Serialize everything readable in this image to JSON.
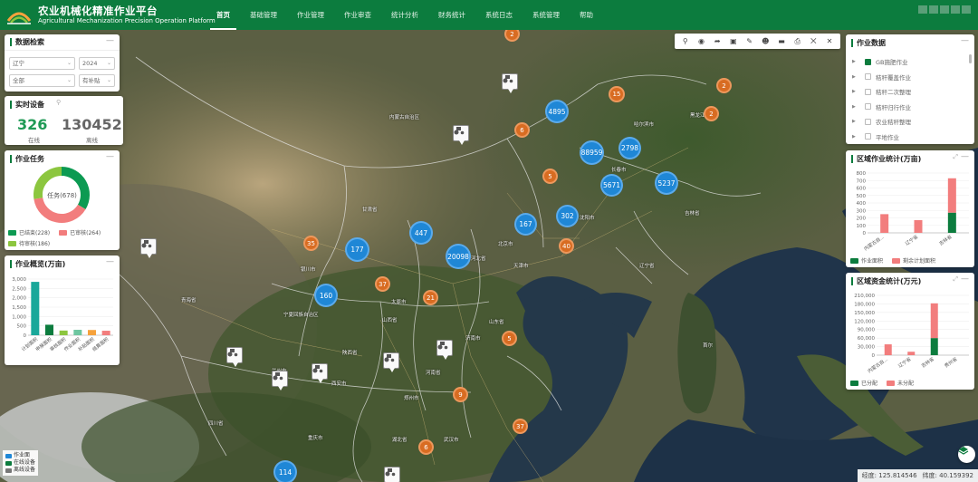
{
  "header": {
    "title": "农业机械化精准作业平台",
    "subtitle": "Agricultural Mechanization Precision Operation Platform",
    "nav": [
      "首页",
      "基础管理",
      "作业管理",
      "作业审查",
      "统计分析",
      "财务统计",
      "系统日志",
      "系统管理",
      "帮助"
    ],
    "active_nav": "首页"
  },
  "search_panel": {
    "title": "数据检索",
    "region_select": "辽宁",
    "year_select": "2024",
    "type_select": "全部",
    "subsidy_select": "有补贴"
  },
  "realtime_panel": {
    "title": "实时设备",
    "online_value": "326",
    "online_label": "在线",
    "offline_value": "130452",
    "offline_label": "离线"
  },
  "task_panel": {
    "title": "作业任务",
    "center_text": "任务(678)",
    "legend": [
      {
        "label": "已结束(228)",
        "color": "#0c9a52"
      },
      {
        "label": "已审核(264)",
        "color": "#f27d7d"
      },
      {
        "label": "待审核(186)",
        "color": "#8cc63f"
      }
    ],
    "chart_data": {
      "type": "pie",
      "categories": [
        "已结束",
        "已审核",
        "待审核"
      ],
      "values": [
        228,
        264,
        186
      ]
    }
  },
  "overview_panel": {
    "title": "作业概览(万亩)",
    "chart_data": {
      "type": "bar",
      "categories": [
        "计划面积",
        "申报面积",
        "审核面积",
        "作业面积",
        "补贴面积",
        "结算面积"
      ],
      "values": [
        2850,
        560,
        250,
        290,
        280,
        240
      ],
      "yticks": [
        "3,000",
        "2,500",
        "2,000",
        "1,500",
        "1,000",
        "500",
        "0"
      ],
      "ylim": [
        0,
        3000
      ],
      "colors": [
        "#1aa89a",
        "#0c7c3e",
        "#8cc63f",
        "#6ec6a0",
        "#f6a23c",
        "#f27d7d"
      ]
    }
  },
  "work_data_panel": {
    "title": "作业数据",
    "items": [
      "GB施肥作业",
      "秸秆覆盖作业",
      "秸秆二次整理",
      "秸秆归行作业",
      "农业秸秆整理",
      "平地作业"
    ],
    "checked_index": 0
  },
  "region_work_panel": {
    "title": "区域作业统计(万亩)",
    "legend": [
      {
        "label": "作业面积",
        "color": "#0c7c3e"
      },
      {
        "label": "剩余计划面积",
        "color": "#f27d7d"
      }
    ],
    "chart_data": {
      "type": "bar",
      "categories": [
        "内蒙古自...",
        "辽宁省",
        "吉林省"
      ],
      "series": [
        {
          "name": "作业面积",
          "values": [
            0,
            0,
            270
          ]
        },
        {
          "name": "剩余计划面积",
          "values": [
            250,
            170,
            460
          ]
        }
      ],
      "yticks": [
        "800",
        "700",
        "600",
        "500",
        "400",
        "300",
        "200",
        "100",
        "0"
      ],
      "ylim": [
        0,
        800
      ]
    }
  },
  "region_fund_panel": {
    "title": "区域资金统计(万元)",
    "legend": [
      {
        "label": "已分配",
        "color": "#0c7c3e"
      },
      {
        "label": "未分配",
        "color": "#f27d7d"
      }
    ],
    "chart_data": {
      "type": "bar",
      "categories": [
        "内蒙古自...",
        "辽宁省",
        "吉林省",
        "贵州省"
      ],
      "series": [
        {
          "name": "已分配",
          "values": [
            0,
            0,
            60000,
            0
          ]
        },
        {
          "name": "未分配",
          "values": [
            38000,
            12000,
            122000,
            0
          ]
        }
      ],
      "yticks": [
        "210,000",
        "180,000",
        "150,000",
        "120,000",
        "90,000",
        "60,000",
        "30,000",
        "0"
      ],
      "ylim": [
        0,
        210000
      ]
    }
  },
  "map": {
    "blue_clusters": [
      "4895",
      "88959",
      "2798",
      "5671",
      "5237",
      "302",
      "167",
      "447",
      "177",
      "20098",
      "160",
      "114"
    ],
    "orange_clusters": [
      "2",
      "15",
      "2",
      "2",
      "6",
      "5",
      "35",
      "40",
      "37",
      "21",
      "5",
      "9",
      "37",
      "6"
    ],
    "labels": [
      "内蒙古自治区",
      "甘肃省",
      "宁夏回族自治区",
      "河北省",
      "北京市",
      "天津市",
      "山西省",
      "陕西省",
      "河南省",
      "山东省",
      "辽宁省",
      "吉林省",
      "黑龙江省",
      "长春市",
      "沈阳市",
      "哈尔滨市",
      "青海省",
      "四川省",
      "湖北省",
      "重庆市",
      "首尔",
      "济南市",
      "太原市",
      "郑州市",
      "西安市",
      "兰州市",
      "武汉市",
      "银川市"
    ],
    "legend": [
      "作业面",
      "在线设备",
      "离线设备"
    ]
  },
  "status_bar": {
    "lon_label": "经度:",
    "lon_value": "125.814546",
    "lat_label": "纬度:",
    "lat_value": "40.159392"
  },
  "toolbar_icons": [
    "search-icon",
    "location-icon",
    "pointer-icon",
    "select-icon",
    "draw-icon",
    "person-icon",
    "ruler-icon",
    "print-icon",
    "trash-icon",
    "close-icon"
  ]
}
